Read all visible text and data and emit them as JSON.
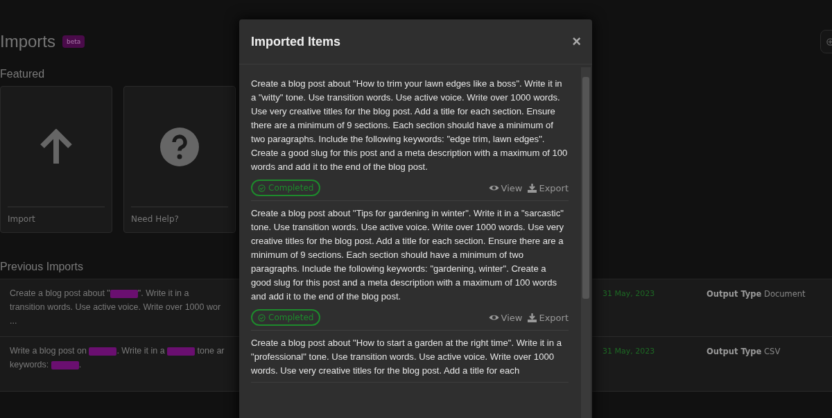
{
  "page": {
    "title": "Imports",
    "badge": "beta"
  },
  "featured": {
    "heading": "Featured",
    "cards": [
      {
        "kind": "upload",
        "label": "Import"
      },
      {
        "kind": "help",
        "label": "Need Help?"
      }
    ]
  },
  "previous": {
    "heading": "Previous Imports",
    "rows": [
      {
        "lines": [
          [
            {
              "kind": "text",
              "text": "Create a blog post about \""
            },
            {
              "kind": "tag"
            },
            {
              "kind": "text",
              "text": "\". Write it in a"
            }
          ],
          [
            {
              "kind": "text",
              "text": "transition words. Use active voice. Write over 1000 wor"
            }
          ],
          [
            {
              "kind": "text",
              "text": "..."
            }
          ]
        ],
        "date": "31 May, 2023",
        "output_label": "Output Type",
        "output_value": "Document"
      },
      {
        "lines": [
          [
            {
              "kind": "text",
              "text": "Write a blog post on "
            },
            {
              "kind": "tag"
            },
            {
              "kind": "text",
              "text": ". Write it in a "
            },
            {
              "kind": "tag"
            },
            {
              "kind": "text",
              "text": " tone ar"
            }
          ],
          [
            {
              "kind": "text",
              "text": "keywords: "
            },
            {
              "kind": "tag"
            },
            {
              "kind": "text",
              "text": "."
            }
          ]
        ],
        "date": "31 May, 2023",
        "output_label": "Output Type",
        "output_value": "CSV"
      }
    ]
  },
  "modal": {
    "title": "Imported Items",
    "close": "×",
    "items": [
      {
        "text": "Create a blog post about \"How to trim your lawn edges like a boss\". Write it in a \"witty\" tone. Use transition words. Use active voice. Write over 1000 words. Use very creative titles for the blog post. Add a title for each section. Ensure there are a minimum of 9 sections. Each section should have a minimum of two paragraphs. Include the following keywords: \"edge trim, lawn edges\". Create a good slug for this post and a meta description with a maximum of 100 words and add it to the end of the blog post.",
        "status": {
          "kind": "completed",
          "label": "Completed"
        },
        "actions": [
          "View",
          "Export"
        ]
      },
      {
        "text": "Create a blog post about \"Tips for gardening in winter\". Write it in a \"sarcastic\" tone. Use transition words. Use active voice. Write over 1000 words. Use very creative titles for the blog post. Add a title for each section. Ensure there are a minimum of 9 sections. Each section should have a minimum of two paragraphs. Include the following keywords: \"gardening, winter\". Create a good slug for this post and a meta description with a maximum of 100 words and add it to the end of the blog post.",
        "status": {
          "kind": "completed",
          "label": "Completed"
        },
        "actions": [
          "View",
          "Export"
        ]
      },
      {
        "text": "Create a blog post about \"How to start a garden at the right time\". Write it in a \"professional\" tone. Use transition words. Use active voice. Write over 1000 words. Use very creative titles for the blog post. Add a title for each"
      }
    ]
  }
}
